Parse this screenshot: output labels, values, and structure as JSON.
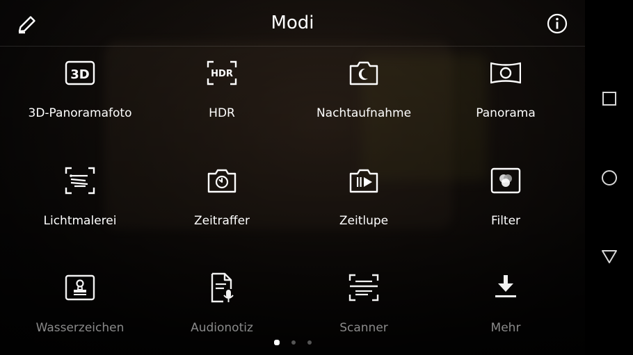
{
  "header": {
    "title": "Modi"
  },
  "icons": {
    "edit": "pencil-icon",
    "info": "info-icon"
  },
  "modes": [
    {
      "label": "3D-Panoramafoto",
      "icon": "3d-icon",
      "enabled": true
    },
    {
      "label": "HDR",
      "icon": "hdr-icon",
      "enabled": true
    },
    {
      "label": "Nachtaufnahme",
      "icon": "night-camera-icon",
      "enabled": true
    },
    {
      "label": "Panorama",
      "icon": "panorama-icon",
      "enabled": true
    },
    {
      "label": "Lichtmalerei",
      "icon": "light-painting-icon",
      "enabled": true
    },
    {
      "label": "Zeitraffer",
      "icon": "timelapse-icon",
      "enabled": true
    },
    {
      "label": "Zeitlupe",
      "icon": "slow-motion-icon",
      "enabled": true
    },
    {
      "label": "Filter",
      "icon": "filter-icon",
      "enabled": true
    },
    {
      "label": "Wasserzeichen",
      "icon": "watermark-icon",
      "enabled": false
    },
    {
      "label": "Audionotiz",
      "icon": "audio-note-icon",
      "enabled": false
    },
    {
      "label": "Scanner",
      "icon": "scanner-icon",
      "enabled": false
    },
    {
      "label": "Mehr",
      "icon": "download-icon",
      "enabled": false
    }
  ],
  "pager": {
    "page": 1,
    "total": 3
  },
  "navigation": [
    "recents-square-icon",
    "home-circle-icon",
    "back-triangle-icon"
  ],
  "colors": {
    "text": "#ffffff",
    "dimmed_text": "#8a8a8a",
    "active_dot": "#ffffff",
    "inactive_dot": "#555555"
  }
}
